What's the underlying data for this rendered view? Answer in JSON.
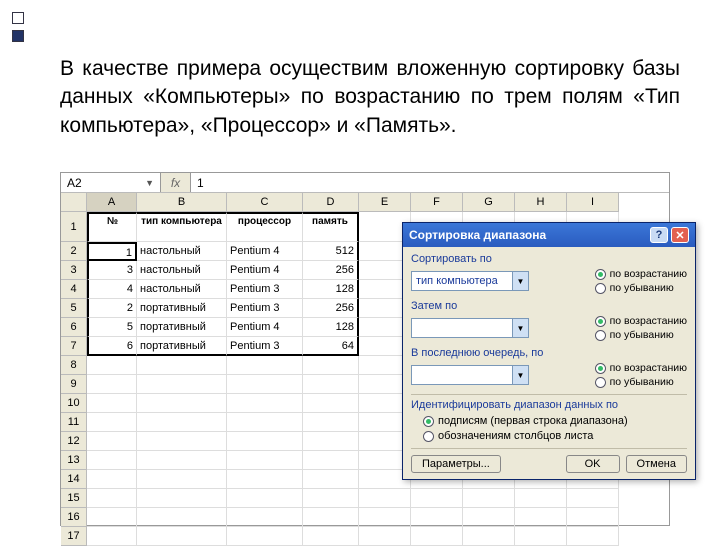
{
  "slide_text": "В качестве примера осуществим вложенную сортировку базы данных «Компьютеры» по возрастанию по трем полям «Тип компьютера», «Процессор» и «Память».",
  "namebox": "A2",
  "formula": "1",
  "fx_label": "fx",
  "col_headers": [
    "A",
    "B",
    "C",
    "D",
    "E",
    "F",
    "G",
    "H",
    "I"
  ],
  "row_numbers": [
    "1",
    "2",
    "3",
    "4",
    "5",
    "6",
    "7",
    "8",
    "9",
    "10",
    "11",
    "12",
    "13",
    "14",
    "15",
    "16",
    "17"
  ],
  "table_headers": {
    "no": "№",
    "type": "тип компьютера",
    "cpu": "процессор",
    "mem": "память"
  },
  "rows": [
    {
      "no": "1",
      "type": "настольный",
      "cpu": "Pentium 4",
      "mem": "512"
    },
    {
      "no": "3",
      "type": "настольный",
      "cpu": "Pentium 4",
      "mem": "256"
    },
    {
      "no": "4",
      "type": "настольный",
      "cpu": "Pentium 3",
      "mem": "128"
    },
    {
      "no": "2",
      "type": "портативный",
      "cpu": "Pentium 3",
      "mem": "256"
    },
    {
      "no": "5",
      "type": "портативный",
      "cpu": "Pentium 4",
      "mem": "128"
    },
    {
      "no": "6",
      "type": "портативный",
      "cpu": "Pentium 3",
      "mem": "64"
    }
  ],
  "dialog": {
    "title": "Сортировка диапазона",
    "sort_by": "Сортировать по",
    "then_by": "Затем по",
    "finally_by": "В последнюю очередь, по",
    "asc": "по возрастанию",
    "desc": "по убыванию",
    "field1": "тип компьютера",
    "field2": "",
    "field3": "",
    "ident_title": "Идентифицировать диапазон данных по",
    "ident_opt1": "подписям (первая строка диапазона)",
    "ident_opt2": "обозначениям столбцов листа",
    "params": "Параметры...",
    "ok": "OK",
    "cancel": "Отмена"
  }
}
